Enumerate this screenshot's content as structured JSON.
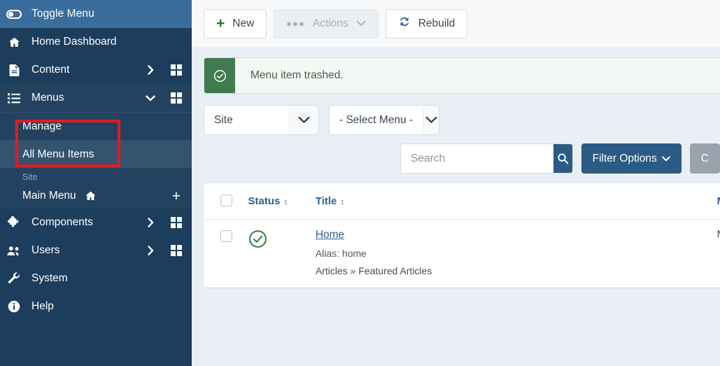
{
  "sidebar": {
    "toggle": {
      "label": "Toggle Menu",
      "icon": "toggle-switch-icon"
    },
    "items": [
      {
        "label": "Home Dashboard",
        "icon": "home-icon",
        "caret": "",
        "grid": false
      },
      {
        "label": "Content",
        "icon": "document-icon",
        "caret": "›",
        "grid": true
      },
      {
        "label": "Menus",
        "icon": "list-icon",
        "caret": "⌄",
        "grid": true
      }
    ],
    "submenu": [
      {
        "label": "Manage",
        "active": false
      },
      {
        "label": "All Menu Items",
        "active": true
      }
    ],
    "site_label": "Site",
    "menu_entry": {
      "label": "Main Menu",
      "icon": "home-icon",
      "add": "+"
    },
    "items_bottom": [
      {
        "label": "Components",
        "icon": "puzzle-icon",
        "caret": "›",
        "grid": true
      },
      {
        "label": "Users",
        "icon": "users-icon",
        "caret": "›",
        "grid": true
      },
      {
        "label": "System",
        "icon": "wrench-icon",
        "caret": "",
        "grid": false
      },
      {
        "label": "Help",
        "icon": "info-icon",
        "caret": "",
        "grid": false
      }
    ]
  },
  "toolbar": {
    "new_label": "New",
    "actions_label": "Actions",
    "rebuild_label": "Rebuild"
  },
  "alert": {
    "message": "Menu item trashed.",
    "icon": "check-circle-icon",
    "accent": "#3f7b4e"
  },
  "filters": {
    "site_select": "Site",
    "menu_select": "- Select Menu -"
  },
  "search": {
    "placeholder": "Search",
    "value": "",
    "icon": "search-icon",
    "filter_options_label": "Filter Options",
    "clear_label": "C"
  },
  "table": {
    "columns": [
      {
        "key": "checkbox",
        "label": ""
      },
      {
        "key": "status",
        "label": "Status",
        "sortable": true
      },
      {
        "key": "title",
        "label": "Title",
        "sortable": true
      },
      {
        "key": "menu",
        "label": "M"
      }
    ],
    "sort_glyph": "↕",
    "rows": [
      {
        "checked": false,
        "status": "published",
        "status_icon": "check-circle-icon",
        "title": "Home",
        "alias": "Alias: home",
        "path": "Articles » Featured Articles",
        "menu": "M"
      }
    ]
  },
  "colors": {
    "sidebar_bg": "#1c3d5c",
    "sidebar_expanded": "#23425f",
    "sidebar_active": "#34536f",
    "toggle_bg": "#3b6d9c",
    "accent_blue": "#2b5b85",
    "link_blue": "#2e5f96",
    "annotation_red": "#e01b22",
    "success_green": "#3f7b4e",
    "page_bg": "#eaeff5"
  }
}
